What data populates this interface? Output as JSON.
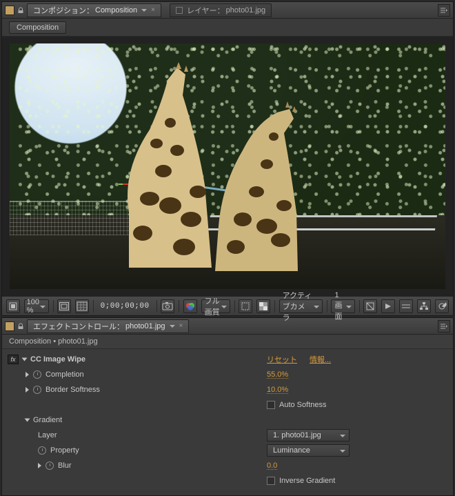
{
  "top_panel": {
    "tabs": [
      {
        "prefix": "コンポジション：",
        "name": "Composition"
      },
      {
        "prefix": "レイヤー：",
        "name": "photo01.jpg"
      }
    ],
    "flowchart_label": "Composition"
  },
  "viewer_toolbar": {
    "zoom": "100 %",
    "timecode": "0;00;00;00",
    "quality": "フル画質",
    "camera": "アクティブカメラ",
    "views": "1画面"
  },
  "effects_panel": {
    "tab_prefix": "エフェクトコントロール：",
    "tab_name": "photo01.jpg",
    "breadcrumb_comp": "Composition",
    "breadcrumb_sep": " • ",
    "breadcrumb_layer": "photo01.jpg",
    "effect": {
      "name": "CC Image Wipe",
      "reset_label": "リセット",
      "about_label": "情報...",
      "params": {
        "completion": {
          "label": "Completion",
          "value": "55.0%"
        },
        "border_softness": {
          "label": "Border Softness",
          "value": "10.0%"
        },
        "auto_softness": {
          "label": "Auto Softness",
          "checked": false
        },
        "gradient": {
          "label": "Gradient",
          "layer": {
            "label": "Layer",
            "value": "1. photo01.jpg"
          },
          "property": {
            "label": "Property",
            "value": "Luminance"
          },
          "blur": {
            "label": "Blur",
            "value": "0.0"
          },
          "inverse": {
            "label": "Inverse Gradient",
            "checked": false
          }
        }
      }
    }
  }
}
